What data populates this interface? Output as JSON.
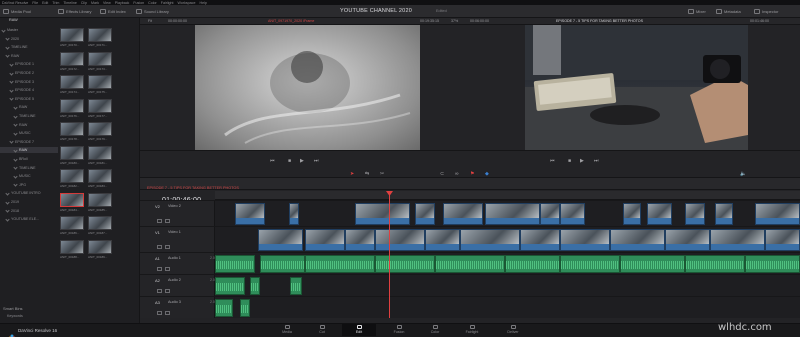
{
  "menubar": {
    "items": [
      "DaVinci Resolve",
      "File",
      "Edit",
      "Trim",
      "Timeline",
      "Clip",
      "Mark",
      "View",
      "Playback",
      "Fusion",
      "Color",
      "Fairlight",
      "Workspace",
      "Help"
    ]
  },
  "toolbar": {
    "media_pool": "Media Pool",
    "effects_library": "Effects Library",
    "edit_index": "Edit Index",
    "sound_library": "Sound Library",
    "mixer": "Mixer",
    "metadata": "Metadata",
    "inspector": "Inspector"
  },
  "project": {
    "title": "YOUTUBE CHANNEL 2020",
    "status": "Edited"
  },
  "viewer": {
    "left_zoom": "Fit",
    "left_tc": "00:00:00:00",
    "left_clip": "ANIT_0971970_2020 iFrame",
    "mid_tc": "00:19:35:15",
    "mid_zoom": "37%",
    "right_tc_a": "00:06:00:00",
    "right_title": "EPISODE 7 - 5 TIPS FOR TAKING BETTER PHOTOS",
    "right_tc_b": "00:01:46:00"
  },
  "media_pool": {
    "bin_title": "RAW",
    "tree": [
      {
        "label": "Master",
        "sel": false
      },
      {
        "label": "2020",
        "sel": false
      },
      {
        "label": "TIMELINE",
        "sel": false
      },
      {
        "label": "RAW",
        "sel": false
      },
      {
        "label": "EPISODE 1",
        "sel": false
      },
      {
        "label": "EPISODE 2",
        "sel": false
      },
      {
        "label": "EPISODE 3",
        "sel": false
      },
      {
        "label": "EPISODE 4",
        "sel": false
      },
      {
        "label": "EPISODE 5",
        "sel": false
      },
      {
        "label": "RAW",
        "sel": false
      },
      {
        "label": "TIMELINE",
        "sel": false
      },
      {
        "label": "RAW",
        "sel": false
      },
      {
        "label": "MUSIC",
        "sel": false
      },
      {
        "label": "EPISODE 7",
        "sel": false
      },
      {
        "label": "RAW",
        "sel": true
      },
      {
        "label": "BRoll",
        "sel": false
      },
      {
        "label": "TIMELINE",
        "sel": false
      },
      {
        "label": "MUSIC",
        "sel": false
      },
      {
        "label": "JPG",
        "sel": false
      },
      {
        "label": "YOUTUBE INTRO",
        "sel": false
      },
      {
        "label": "2019",
        "sel": false
      },
      {
        "label": "2018",
        "sel": false
      },
      {
        "label": "YOUTUBE ELE...",
        "sel": false
      }
    ],
    "clips": [
      "ANIT_00170...",
      "ANIT_00171...",
      "ANIT_00172...",
      "ANIT_00173...",
      "ANIT_00174...",
      "ANIT_00175...",
      "ANIT_00176...",
      "ANIT_00177...",
      "ANIT_00178...",
      "ANIT_00179...",
      "ANIT_00180...",
      "ANIT_00181...",
      "ANIT_00182...",
      "ANIT_00183...",
      "ANIT_00184...",
      "ANIT_00185...",
      "ANIT_00186...",
      "ANIT_00187...",
      "ANIT_00188...",
      "ANIT_00189..."
    ],
    "smart_bins": "Smart Bins",
    "keywords": "Keywords"
  },
  "timeline": {
    "name": "EPISODE 7 - 5 TIPS FOR TAKING BETTER PHOTOS",
    "timecode": "01:00:46:00",
    "tracks": [
      {
        "id": "V2",
        "name": "Video 2",
        "ch": ""
      },
      {
        "id": "V1",
        "name": "Video 1",
        "ch": ""
      },
      {
        "id": "A1",
        "name": "Audio 1",
        "ch": "2.0"
      },
      {
        "id": "A2",
        "name": "Audio 2",
        "ch": "2.0"
      },
      {
        "id": "A3",
        "name": "Audio 3",
        "ch": "2.0"
      }
    ]
  },
  "pages": {
    "app_name": "DaVinci Resolve 16",
    "items": [
      {
        "label": "Media",
        "active": false
      },
      {
        "label": "Cut",
        "active": false
      },
      {
        "label": "Edit",
        "active": true
      },
      {
        "label": "Fusion",
        "active": false
      },
      {
        "label": "Color",
        "active": false
      },
      {
        "label": "Fairlight",
        "active": false
      },
      {
        "label": "Deliver",
        "active": false
      }
    ]
  },
  "colors": {
    "accent_red": "#e04040",
    "video_clip": "#3a6fa6",
    "audio_clip": "#2f8d5a",
    "panel_bg": "#232326"
  },
  "icons": [
    "media-pool-icon",
    "effects-icon",
    "edit-index-icon",
    "sound-library-icon",
    "mixer-icon",
    "metadata-icon",
    "inspector-icon",
    "play-icon",
    "stop-icon",
    "rewind-icon",
    "forward-icon",
    "loop-icon",
    "blade-icon",
    "select-icon",
    "link-icon",
    "snap-icon",
    "flag-icon",
    "marker-icon",
    "lock-icon",
    "eye-icon",
    "mute-icon",
    "solo-icon",
    "davinci-logo-icon"
  ]
}
